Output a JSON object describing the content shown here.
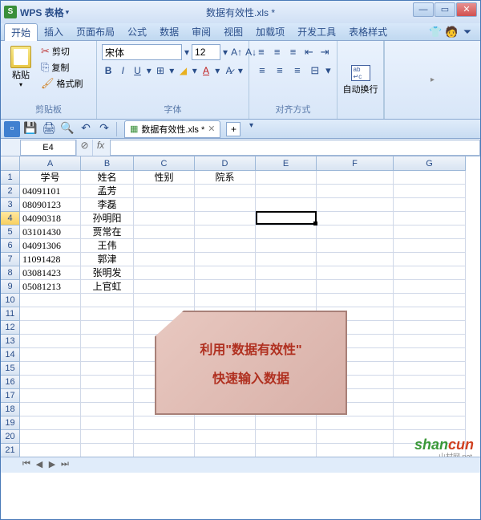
{
  "app": {
    "name": "WPS 表格",
    "doc_title": "数据有效性.xls *"
  },
  "win": {
    "min": "—",
    "max": "▭",
    "close": "✕"
  },
  "menu": {
    "items": [
      "开始",
      "插入",
      "页面布局",
      "公式",
      "数据",
      "审阅",
      "视图",
      "加载项",
      "开发工具",
      "表格样式"
    ],
    "active_index": 0
  },
  "ribbon": {
    "clipboard": {
      "paste": "粘贴",
      "cut": "剪切",
      "copy": "复制",
      "format_painter": "格式刷",
      "label": "剪贴板"
    },
    "font": {
      "name": "宋体",
      "size": "12",
      "label": "字体"
    },
    "align": {
      "wrap": "自动换行",
      "label": "对齐方式"
    }
  },
  "qat": {
    "tab_name": "数据有效性.xls *"
  },
  "formula_bar": {
    "cell_ref": "E4",
    "fx": "fx"
  },
  "columns": [
    "A",
    "B",
    "C",
    "D",
    "E",
    "F",
    "G"
  ],
  "row_count": 22,
  "active_row": 4,
  "active_cell": "E4",
  "data": {
    "headers": [
      "学号",
      "姓名",
      "性别",
      "院系"
    ],
    "rows": [
      {
        "a": "04091101",
        "b": "孟芳"
      },
      {
        "a": "08090123",
        "b": "李磊"
      },
      {
        "a": "04090318",
        "b": "孙明阳"
      },
      {
        "a": "03101430",
        "b": "贾常在"
      },
      {
        "a": "04091306",
        "b": "王伟"
      },
      {
        "a": "11091428",
        "b": "郭津"
      },
      {
        "a": "03081423",
        "b": "张明发"
      },
      {
        "a": "05081213",
        "b": "上官虹"
      }
    ]
  },
  "callout": {
    "line1": "利用\"数据有效性\"",
    "line2": "快速输入数据"
  },
  "watermark": {
    "text1": "shan",
    "text2": "cun",
    "sub": "山村网.net"
  }
}
